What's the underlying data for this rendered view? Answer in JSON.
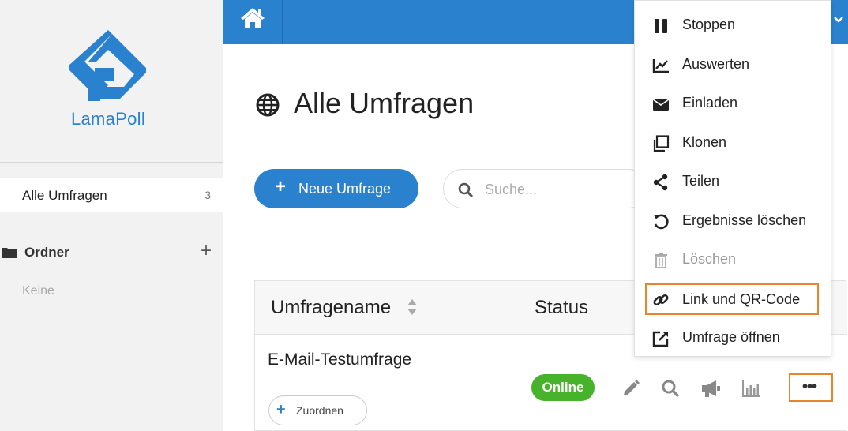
{
  "sidebar": {
    "brand": "LamaPoll",
    "all_surveys": {
      "label": "Alle Umfragen",
      "count": "3"
    },
    "folders": {
      "label": "Ordner",
      "add": "+",
      "empty": "Keine"
    }
  },
  "header": {
    "home_icon": "home-icon",
    "color": "#2a82cf"
  },
  "main": {
    "title": "Alle Umfragen",
    "new_button": {
      "plus": "+",
      "label": "Neue Umfrage"
    },
    "search": {
      "placeholder": "Suche..."
    },
    "table": {
      "columns": [
        "Umfragename",
        "Status"
      ],
      "rows": [
        {
          "name": "E-Mail-Testumfrage",
          "assign": "Zuordnen",
          "assign_plus": "+",
          "status": "Online",
          "more": "•••"
        }
      ]
    }
  },
  "menu": {
    "items": [
      {
        "label": "Stoppen",
        "icon": "pause-icon"
      },
      {
        "label": "Auswerten",
        "icon": "chart-icon"
      },
      {
        "label": "Einladen",
        "icon": "envelope-icon"
      },
      {
        "label": "Klonen",
        "icon": "clone-icon"
      },
      {
        "label": "Teilen",
        "icon": "share-icon"
      },
      {
        "label": "Ergebnisse löschen",
        "icon": "undo-icon"
      },
      {
        "label": "Löschen",
        "icon": "trash-icon",
        "disabled": true
      },
      {
        "label": "Link und QR-Code",
        "icon": "link-icon",
        "highlighted": true
      },
      {
        "label": "Umfrage öffnen",
        "icon": "external-link-icon"
      }
    ]
  },
  "colors": {
    "accent": "#2a82cf",
    "online": "#46b32a",
    "highlight": "#e8842c"
  }
}
